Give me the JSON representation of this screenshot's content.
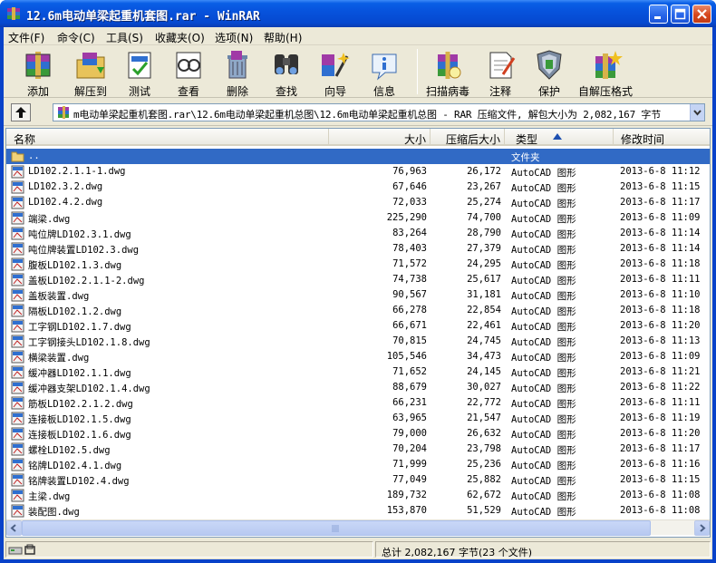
{
  "window": {
    "title": "12.6m电动单梁起重机套图.rar - WinRAR",
    "minimize_label": "Minimize",
    "maximize_label": "Maximize",
    "close_label": "Close"
  },
  "menu": [
    {
      "label": "文件(F)"
    },
    {
      "label": "命令(C)"
    },
    {
      "label": "工具(S)"
    },
    {
      "label": "收藏夹(O)"
    },
    {
      "label": "选项(N)"
    },
    {
      "label": "帮助(H)"
    }
  ],
  "toolbar": [
    {
      "label": "添加",
      "icon": "add-archive-icon"
    },
    {
      "label": "解压到",
      "icon": "extract-to-icon"
    },
    {
      "label": "测试",
      "icon": "test-icon"
    },
    {
      "label": "查看",
      "icon": "view-icon"
    },
    {
      "label": "删除",
      "icon": "delete-icon"
    },
    {
      "label": "查找",
      "icon": "find-icon"
    },
    {
      "label": "向导",
      "icon": "wizard-icon"
    },
    {
      "label": "信息",
      "icon": "info-icon"
    },
    {
      "label": "扫描病毒",
      "icon": "virus-scan-icon"
    },
    {
      "label": "注释",
      "icon": "comment-icon"
    },
    {
      "label": "保护",
      "icon": "protect-icon"
    },
    {
      "label": "自解压格式",
      "icon": "sfx-icon"
    }
  ],
  "address": {
    "path": "m电动单梁起重机套图.rar\\12.6m电动单梁起重机总图\\12.6m电动单梁起重机总图 - RAR 压缩文件, 解包大小为 2,082,167 字节"
  },
  "columns": {
    "name": "名称",
    "size": "大小",
    "packed": "压缩后大小",
    "type": "类型",
    "modified": "修改时间"
  },
  "parent_row": {
    "name": "..",
    "type": "文件夹"
  },
  "files": [
    {
      "name": "LD102.2.1.1-1.dwg",
      "size": "76,963",
      "packed": "26,172",
      "type": "AutoCAD 图形",
      "modified": "2013-6-8 11:12"
    },
    {
      "name": "LD102.3.2.dwg",
      "size": "67,646",
      "packed": "23,267",
      "type": "AutoCAD 图形",
      "modified": "2013-6-8 11:15"
    },
    {
      "name": "LD102.4.2.dwg",
      "size": "72,033",
      "packed": "25,274",
      "type": "AutoCAD 图形",
      "modified": "2013-6-8 11:17"
    },
    {
      "name": "端梁.dwg",
      "size": "225,290",
      "packed": "74,700",
      "type": "AutoCAD 图形",
      "modified": "2013-6-8 11:09"
    },
    {
      "name": "吨位牌LD102.3.1.dwg",
      "size": "83,264",
      "packed": "28,790",
      "type": "AutoCAD 图形",
      "modified": "2013-6-8 11:14"
    },
    {
      "name": "吨位牌装置LD102.3.dwg",
      "size": "78,403",
      "packed": "27,379",
      "type": "AutoCAD 图形",
      "modified": "2013-6-8 11:14"
    },
    {
      "name": "腹板LD102.1.3.dwg",
      "size": "71,572",
      "packed": "24,295",
      "type": "AutoCAD 图形",
      "modified": "2013-6-8 11:18"
    },
    {
      "name": "盖板LD102.2.1.1-2.dwg",
      "size": "74,738",
      "packed": "25,617",
      "type": "AutoCAD 图形",
      "modified": "2013-6-8 11:11"
    },
    {
      "name": "盖板装置.dwg",
      "size": "90,567",
      "packed": "31,181",
      "type": "AutoCAD 图形",
      "modified": "2013-6-8 11:10"
    },
    {
      "name": "隔板LD102.1.2.dwg",
      "size": "66,278",
      "packed": "22,854",
      "type": "AutoCAD 图形",
      "modified": "2013-6-8 11:18"
    },
    {
      "name": "工字钢LD102.1.7.dwg",
      "size": "66,671",
      "packed": "22,461",
      "type": "AutoCAD 图形",
      "modified": "2013-6-8 11:20"
    },
    {
      "name": "工字钢接头LD102.1.8.dwg",
      "size": "70,815",
      "packed": "24,745",
      "type": "AutoCAD 图形",
      "modified": "2013-6-8 11:13"
    },
    {
      "name": "横梁装置.dwg",
      "size": "105,546",
      "packed": "34,473",
      "type": "AutoCAD 图形",
      "modified": "2013-6-8 11:09"
    },
    {
      "name": "缓冲器LD102.1.1.dwg",
      "size": "71,652",
      "packed": "24,145",
      "type": "AutoCAD 图形",
      "modified": "2013-6-8 11:21"
    },
    {
      "name": "缓冲器支架LD102.1.4.dwg",
      "size": "88,679",
      "packed": "30,027",
      "type": "AutoCAD 图形",
      "modified": "2013-6-8 11:22"
    },
    {
      "name": "筋板LD102.2.1.2.dwg",
      "size": "66,231",
      "packed": "22,772",
      "type": "AutoCAD 图形",
      "modified": "2013-6-8 11:11"
    },
    {
      "name": "连接板LD102.1.5.dwg",
      "size": "63,965",
      "packed": "21,547",
      "type": "AutoCAD 图形",
      "modified": "2013-6-8 11:19"
    },
    {
      "name": "连接板LD102.1.6.dwg",
      "size": "79,000",
      "packed": "26,632",
      "type": "AutoCAD 图形",
      "modified": "2013-6-8 11:20"
    },
    {
      "name": "螺栓LD102.5.dwg",
      "size": "70,204",
      "packed": "23,798",
      "type": "AutoCAD 图形",
      "modified": "2013-6-8 11:17"
    },
    {
      "name": "铭牌LD102.4.1.dwg",
      "size": "71,999",
      "packed": "25,236",
      "type": "AutoCAD 图形",
      "modified": "2013-6-8 11:16"
    },
    {
      "name": "铭牌装置LD102.4.dwg",
      "size": "77,049",
      "packed": "25,882",
      "type": "AutoCAD 图形",
      "modified": "2013-6-8 11:15"
    },
    {
      "name": "主梁.dwg",
      "size": "189,732",
      "packed": "62,672",
      "type": "AutoCAD 图形",
      "modified": "2013-6-8 11:08"
    },
    {
      "name": "装配图.dwg",
      "size": "153,870",
      "packed": "51,529",
      "type": "AutoCAD 图形",
      "modified": "2013-6-8 11:08"
    }
  ],
  "status": {
    "total": "总计 2,082,167 字节(23 个文件)"
  },
  "colors": {
    "titlebar": "#0753dd",
    "selection": "#316ac5",
    "face": "#ece9d8"
  }
}
